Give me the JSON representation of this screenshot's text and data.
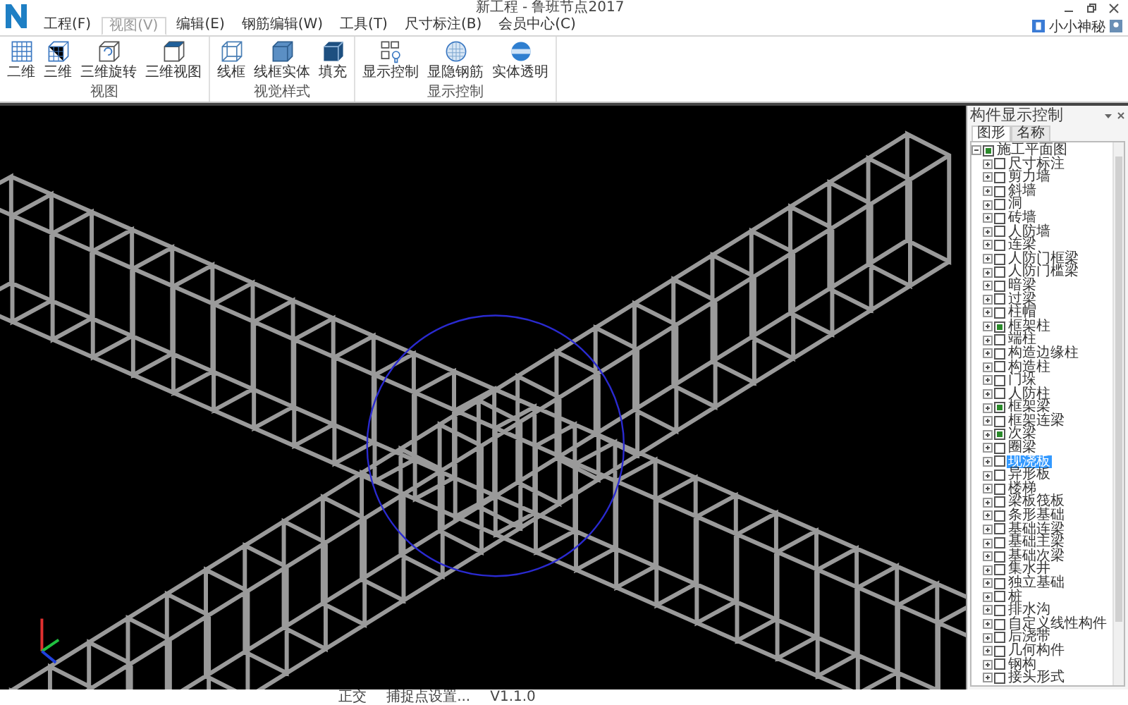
{
  "window": {
    "title": "新工程 - 鲁班节点2017",
    "user": "小小神秘"
  },
  "menu_tabs": [
    {
      "label": "工程(F)",
      "selected": false
    },
    {
      "label": "视图(V)",
      "selected": true
    },
    {
      "label": "编辑(E)",
      "selected": false
    },
    {
      "label": "钢筋编辑(W)",
      "selected": false
    },
    {
      "label": "工具(T)",
      "selected": false
    },
    {
      "label": "尺寸标注(B)",
      "selected": false
    },
    {
      "label": "会员中心(C)",
      "selected": false
    }
  ],
  "ribbon_groups": [
    {
      "title": "视图",
      "buttons": [
        {
          "label": "二维",
          "kind": "grid2d"
        },
        {
          "label": "三维",
          "kind": "grid3d"
        },
        {
          "label": "三维旋转",
          "kind": "rotate"
        },
        {
          "label": "三维视图",
          "kind": "view3d"
        }
      ]
    },
    {
      "title": "视觉样式",
      "buttons": [
        {
          "label": "线框",
          "kind": "wire"
        },
        {
          "label": "线框实体",
          "kind": "solid"
        },
        {
          "label": "填充",
          "kind": "fill"
        }
      ]
    },
    {
      "title": "显示控制",
      "buttons": [
        {
          "label": "显示控制",
          "kind": "display"
        },
        {
          "label": "显隐钢筋",
          "kind": "hatch"
        },
        {
          "label": "实体透明",
          "kind": "transparent"
        }
      ]
    }
  ],
  "panel": {
    "title": "构件显示控制",
    "tabs": [
      {
        "label": "图形",
        "selected": true
      },
      {
        "label": "名称",
        "selected": false
      }
    ],
    "tree": [
      {
        "label": "施工平面图",
        "checked": true,
        "selected": false,
        "expanded": true,
        "children": [
          {
            "label": "尺寸标注",
            "checked": false,
            "selected": false
          },
          {
            "label": "剪力墙",
            "checked": false,
            "selected": false
          },
          {
            "label": "斜墙",
            "checked": false,
            "selected": false
          },
          {
            "label": "洞",
            "checked": false,
            "selected": false
          },
          {
            "label": "砖墙",
            "checked": false,
            "selected": false
          },
          {
            "label": "人防墙",
            "checked": false,
            "selected": false
          },
          {
            "label": "连梁",
            "checked": false,
            "selected": false
          },
          {
            "label": "人防门框梁",
            "checked": false,
            "selected": false
          },
          {
            "label": "人防门槛梁",
            "checked": false,
            "selected": false
          },
          {
            "label": "暗梁",
            "checked": false,
            "selected": false
          },
          {
            "label": "过梁",
            "checked": false,
            "selected": false
          },
          {
            "label": "柱帽",
            "checked": false,
            "selected": false
          },
          {
            "label": "框架柱",
            "checked": true,
            "selected": false
          },
          {
            "label": "端柱",
            "checked": false,
            "selected": false
          },
          {
            "label": "构造边缘柱",
            "checked": false,
            "selected": false
          },
          {
            "label": "构造柱",
            "checked": false,
            "selected": false
          },
          {
            "label": "门垛",
            "checked": false,
            "selected": false
          },
          {
            "label": "人防柱",
            "checked": false,
            "selected": false
          },
          {
            "label": "框架梁",
            "checked": true,
            "selected": false
          },
          {
            "label": "框架连梁",
            "checked": false,
            "selected": false
          },
          {
            "label": "次梁",
            "checked": true,
            "selected": false
          },
          {
            "label": "圈梁",
            "checked": false,
            "selected": false
          },
          {
            "label": "现浇板",
            "checked": false,
            "selected": true
          },
          {
            "label": "异形板",
            "checked": false,
            "selected": false
          },
          {
            "label": "楼梯",
            "checked": false,
            "selected": false
          },
          {
            "label": "梁板筏板",
            "checked": false,
            "selected": false
          },
          {
            "label": "条形基础",
            "checked": false,
            "selected": false
          },
          {
            "label": "基础连梁",
            "checked": false,
            "selected": false
          },
          {
            "label": "基础主梁",
            "checked": false,
            "selected": false
          },
          {
            "label": "基础次梁",
            "checked": false,
            "selected": false
          },
          {
            "label": "集水井",
            "checked": false,
            "selected": false
          },
          {
            "label": "独立基础",
            "checked": false,
            "selected": false
          },
          {
            "label": "桩",
            "checked": false,
            "selected": false
          },
          {
            "label": "排水沟",
            "checked": false,
            "selected": false
          },
          {
            "label": "自定义线性构件",
            "checked": false,
            "selected": false
          },
          {
            "label": "后浇带",
            "checked": false,
            "selected": false
          },
          {
            "label": "几何构件",
            "checked": false,
            "selected": false
          },
          {
            "label": "钢构",
            "checked": false,
            "selected": false
          },
          {
            "label": "接头形式",
            "checked": false,
            "selected": false
          }
        ]
      }
    ]
  },
  "status_bar": [
    "正交",
    "捕捉点设置...",
    "V1.1.0"
  ]
}
